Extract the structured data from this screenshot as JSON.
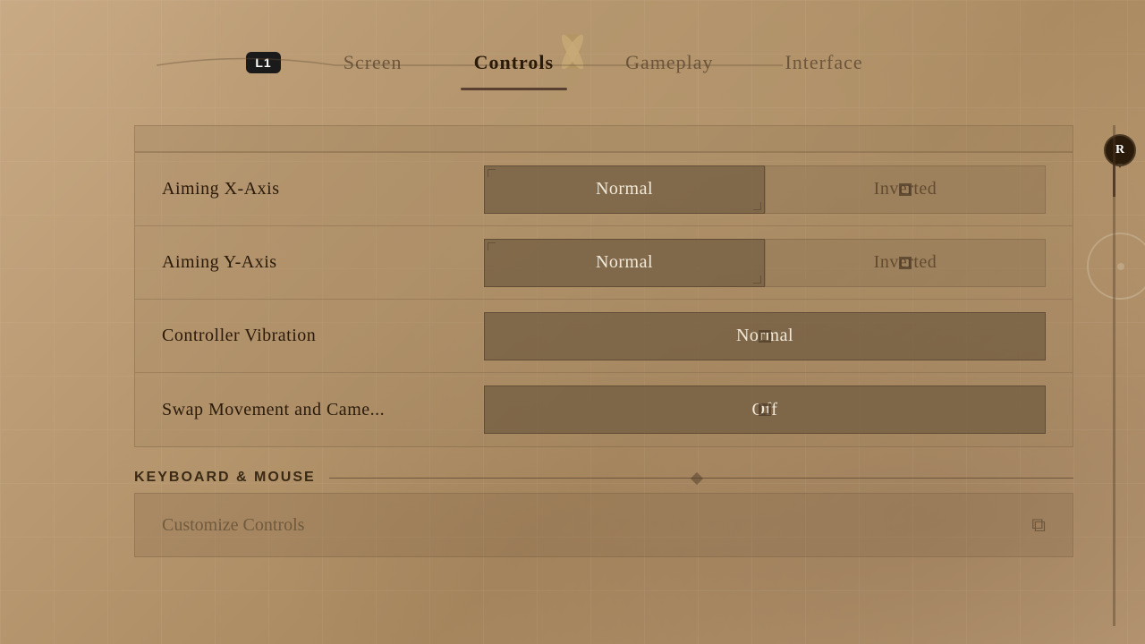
{
  "header": {
    "l1_label": "L1",
    "tabs": [
      {
        "id": "screen",
        "label": "Screen",
        "active": false
      },
      {
        "id": "controls",
        "label": "Controls",
        "active": true
      },
      {
        "id": "gameplay",
        "label": "Gameplay",
        "active": false
      },
      {
        "id": "interface",
        "label": "Interface",
        "active": false
      }
    ]
  },
  "settings": {
    "rows": [
      {
        "label": "Aiming X-Axis",
        "options": [
          "Normal",
          "Inverted"
        ],
        "selected": "Normal"
      },
      {
        "label": "Aiming Y-Axis",
        "options": [
          "Normal",
          "Inverted"
        ],
        "selected": "Normal"
      },
      {
        "label": "Controller Vibration",
        "options": [
          "Normal"
        ],
        "selected": "Normal"
      },
      {
        "label": "Swap Movement and Came...",
        "options": [
          "Off"
        ],
        "selected": "Off"
      }
    ]
  },
  "keyboard_mouse": {
    "section_label": "KEYBOARD & MOUSE",
    "customize_label": "Customize Controls",
    "customize_icon": "⧉"
  },
  "indicators": {
    "r_label": "R"
  }
}
